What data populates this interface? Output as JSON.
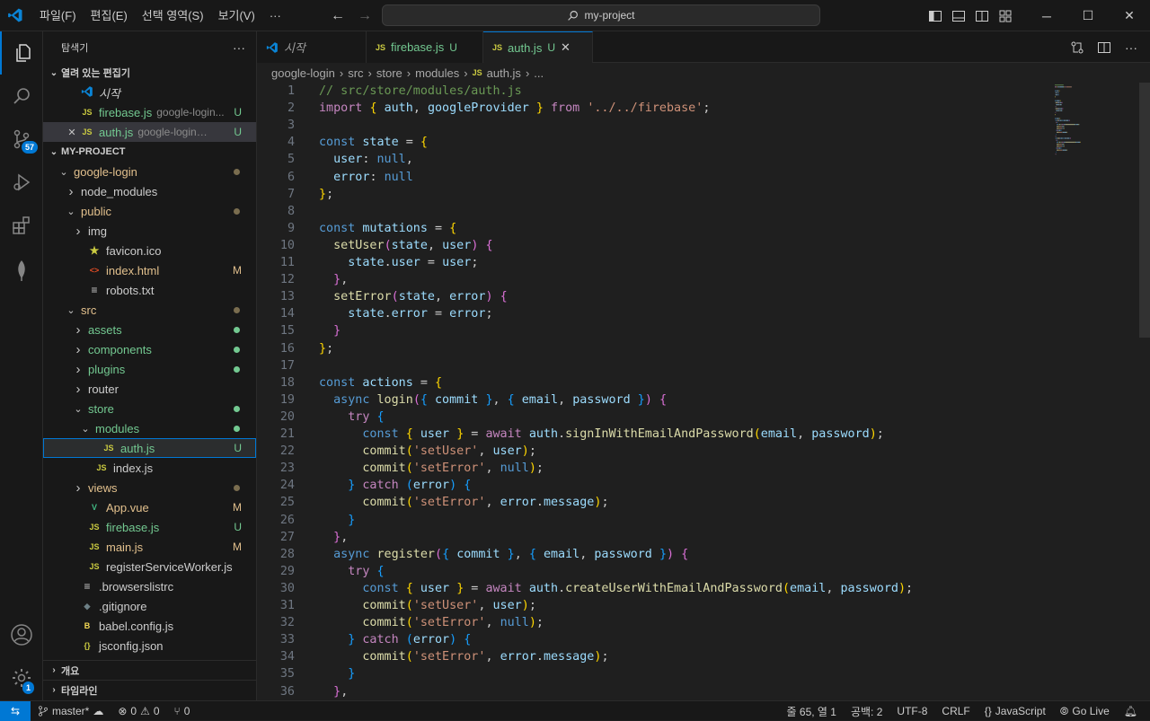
{
  "titlebar": {
    "menu": [
      "파일(F)",
      "편집(E)",
      "선택 영역(S)",
      "보기(V)",
      "···"
    ],
    "search_text": "my-project"
  },
  "activity_bar": {
    "items": [
      "explorer-icon",
      "search-icon",
      "source-control-icon",
      "run-debug-icon",
      "extensions-icon",
      "mongodb-icon"
    ],
    "source_control_badge": "57",
    "settings_badge": "1"
  },
  "sidebar": {
    "title": "탐색기",
    "more": "···",
    "open_editors_label": "열려 있는 편집기",
    "open_editors": [
      {
        "name": "시작",
        "desc": "",
        "status": "",
        "icon": "vscode-icon"
      },
      {
        "name": "firebase.js",
        "desc": "google-login...",
        "status": "U",
        "icon": "JS"
      },
      {
        "name": "auth.js",
        "desc": "google-login\\src...",
        "status": "U",
        "icon": "JS"
      }
    ],
    "project_label": "MY-PROJECT",
    "tree": [
      {
        "name": "google-login",
        "type": "folder-open",
        "depth": 0,
        "status": "dot"
      },
      {
        "name": "node_modules",
        "type": "folder",
        "depth": 1,
        "status": ""
      },
      {
        "name": "public",
        "type": "folder-open",
        "depth": 1,
        "status": "dot"
      },
      {
        "name": "img",
        "type": "folder",
        "depth": 2,
        "status": ""
      },
      {
        "name": "favicon.ico",
        "type": "star",
        "depth": 2,
        "status": ""
      },
      {
        "name": "index.html",
        "type": "html",
        "depth": 2,
        "status": "M"
      },
      {
        "name": "robots.txt",
        "type": "txt",
        "depth": 2,
        "status": ""
      },
      {
        "name": "src",
        "type": "folder-open",
        "depth": 1,
        "status": "dot"
      },
      {
        "name": "assets",
        "type": "folder",
        "depth": 2,
        "status": "dot-green"
      },
      {
        "name": "components",
        "type": "folder",
        "depth": 2,
        "status": "dot-green"
      },
      {
        "name": "plugins",
        "type": "folder",
        "depth": 2,
        "status": "dot-green"
      },
      {
        "name": "router",
        "type": "folder",
        "depth": 2,
        "status": ""
      },
      {
        "name": "store",
        "type": "folder-open",
        "depth": 2,
        "status": "dot-green"
      },
      {
        "name": "modules",
        "type": "folder-open",
        "depth": 3,
        "status": "dot-green"
      },
      {
        "name": "auth.js",
        "type": "js",
        "depth": 4,
        "status": "U"
      },
      {
        "name": "index.js",
        "type": "js",
        "depth": 3,
        "status": ""
      },
      {
        "name": "views",
        "type": "folder",
        "depth": 2,
        "status": "dot"
      },
      {
        "name": "App.vue",
        "type": "vue",
        "depth": 2,
        "status": "M"
      },
      {
        "name": "firebase.js",
        "type": "js",
        "depth": 2,
        "status": "U"
      },
      {
        "name": "main.js",
        "type": "js",
        "depth": 2,
        "status": "M"
      },
      {
        "name": "registerServiceWorker.js",
        "type": "js",
        "depth": 2,
        "status": ""
      },
      {
        "name": ".browserslistrc",
        "type": "txt",
        "depth": 1,
        "status": ""
      },
      {
        "name": ".gitignore",
        "type": "git",
        "depth": 1,
        "status": ""
      },
      {
        "name": "babel.config.js",
        "type": "babel",
        "depth": 1,
        "status": ""
      },
      {
        "name": "jsconfig.json",
        "type": "json",
        "depth": 1,
        "status": ""
      }
    ],
    "outline_label": "개요",
    "timeline_label": "타임라인"
  },
  "tabs": [
    {
      "label": "시작",
      "icon": "vscode-icon",
      "status": ""
    },
    {
      "label": "firebase.js",
      "icon": "JS",
      "status": "U"
    },
    {
      "label": "auth.js",
      "icon": "JS",
      "status": "U",
      "active": true
    }
  ],
  "breadcrumb": [
    "google-login",
    "src",
    "store",
    "modules",
    "auth.js",
    "..."
  ],
  "code_lines": [
    [
      [
        "c",
        "// src/store/modules/auth.js"
      ]
    ],
    [
      [
        "k",
        "import"
      ],
      [
        "p",
        " "
      ],
      [
        "b1",
        "{"
      ],
      [
        "p",
        " "
      ],
      [
        "v",
        "auth"
      ],
      [
        "p",
        ", "
      ],
      [
        "v",
        "googleProvider"
      ],
      [
        "p",
        " "
      ],
      [
        "b1",
        "}"
      ],
      [
        "p",
        " "
      ],
      [
        "k",
        "from"
      ],
      [
        "p",
        " "
      ],
      [
        "s",
        "'../../firebase'"
      ],
      [
        "p",
        ";"
      ]
    ],
    [],
    [
      [
        "kw",
        "const"
      ],
      [
        "p",
        " "
      ],
      [
        "v",
        "state"
      ],
      [
        "p",
        " = "
      ],
      [
        "b1",
        "{"
      ]
    ],
    [
      [
        "p",
        "  "
      ],
      [
        "v",
        "user"
      ],
      [
        "p",
        ": "
      ],
      [
        "kw",
        "null"
      ],
      [
        "p",
        ","
      ]
    ],
    [
      [
        "p",
        "  "
      ],
      [
        "v",
        "error"
      ],
      [
        "p",
        ": "
      ],
      [
        "kw",
        "null"
      ]
    ],
    [
      [
        "b1",
        "}"
      ],
      [
        "p",
        ";"
      ]
    ],
    [],
    [
      [
        "kw",
        "const"
      ],
      [
        "p",
        " "
      ],
      [
        "v",
        "mutations"
      ],
      [
        "p",
        " = "
      ],
      [
        "b1",
        "{"
      ]
    ],
    [
      [
        "p",
        "  "
      ],
      [
        "f",
        "setUser"
      ],
      [
        "b2",
        "("
      ],
      [
        "v",
        "state"
      ],
      [
        "p",
        ", "
      ],
      [
        "v",
        "user"
      ],
      [
        "b2",
        ")"
      ],
      [
        "p",
        " "
      ],
      [
        "b2",
        "{"
      ]
    ],
    [
      [
        "p",
        "    "
      ],
      [
        "v",
        "state"
      ],
      [
        "p",
        "."
      ],
      [
        "v",
        "user"
      ],
      [
        "p",
        " = "
      ],
      [
        "v",
        "user"
      ],
      [
        "p",
        ";"
      ]
    ],
    [
      [
        "p",
        "  "
      ],
      [
        "b2",
        "}"
      ],
      [
        "p",
        ","
      ]
    ],
    [
      [
        "p",
        "  "
      ],
      [
        "f",
        "setError"
      ],
      [
        "b2",
        "("
      ],
      [
        "v",
        "state"
      ],
      [
        "p",
        ", "
      ],
      [
        "v",
        "error"
      ],
      [
        "b2",
        ")"
      ],
      [
        "p",
        " "
      ],
      [
        "b2",
        "{"
      ]
    ],
    [
      [
        "p",
        "    "
      ],
      [
        "v",
        "state"
      ],
      [
        "p",
        "."
      ],
      [
        "v",
        "error"
      ],
      [
        "p",
        " = "
      ],
      [
        "v",
        "error"
      ],
      [
        "p",
        ";"
      ]
    ],
    [
      [
        "p",
        "  "
      ],
      [
        "b2",
        "}"
      ]
    ],
    [
      [
        "b1",
        "}"
      ],
      [
        "p",
        ";"
      ]
    ],
    [],
    [
      [
        "kw",
        "const"
      ],
      [
        "p",
        " "
      ],
      [
        "v",
        "actions"
      ],
      [
        "p",
        " = "
      ],
      [
        "b1",
        "{"
      ]
    ],
    [
      [
        "p",
        "  "
      ],
      [
        "kw",
        "async"
      ],
      [
        "p",
        " "
      ],
      [
        "f",
        "login"
      ],
      [
        "b2",
        "("
      ],
      [
        "b3",
        "{"
      ],
      [
        "p",
        " "
      ],
      [
        "v",
        "commit"
      ],
      [
        "p",
        " "
      ],
      [
        "b3",
        "}"
      ],
      [
        "p",
        ", "
      ],
      [
        "b3",
        "{"
      ],
      [
        "p",
        " "
      ],
      [
        "v",
        "email"
      ],
      [
        "p",
        ", "
      ],
      [
        "v",
        "password"
      ],
      [
        "p",
        " "
      ],
      [
        "b3",
        "}"
      ],
      [
        "b2",
        ")"
      ],
      [
        "p",
        " "
      ],
      [
        "b2",
        "{"
      ]
    ],
    [
      [
        "p",
        "    "
      ],
      [
        "k",
        "try"
      ],
      [
        "p",
        " "
      ],
      [
        "b3",
        "{"
      ]
    ],
    [
      [
        "p",
        "      "
      ],
      [
        "kw",
        "const"
      ],
      [
        "p",
        " "
      ],
      [
        "b1",
        "{"
      ],
      [
        "p",
        " "
      ],
      [
        "v",
        "user"
      ],
      [
        "p",
        " "
      ],
      [
        "b1",
        "}"
      ],
      [
        "p",
        " = "
      ],
      [
        "k",
        "await"
      ],
      [
        "p",
        " "
      ],
      [
        "v",
        "auth"
      ],
      [
        "p",
        "."
      ],
      [
        "f",
        "signInWithEmailAndPassword"
      ],
      [
        "b1",
        "("
      ],
      [
        "v",
        "email"
      ],
      [
        "p",
        ", "
      ],
      [
        "v",
        "password"
      ],
      [
        "b1",
        ")"
      ],
      [
        "p",
        ";"
      ]
    ],
    [
      [
        "p",
        "      "
      ],
      [
        "f",
        "commit"
      ],
      [
        "b1",
        "("
      ],
      [
        "s",
        "'setUser'"
      ],
      [
        "p",
        ", "
      ],
      [
        "v",
        "user"
      ],
      [
        "b1",
        ")"
      ],
      [
        "p",
        ";"
      ]
    ],
    [
      [
        "p",
        "      "
      ],
      [
        "f",
        "commit"
      ],
      [
        "b1",
        "("
      ],
      [
        "s",
        "'setError'"
      ],
      [
        "p",
        ", "
      ],
      [
        "kw",
        "null"
      ],
      [
        "b1",
        ")"
      ],
      [
        "p",
        ";"
      ]
    ],
    [
      [
        "p",
        "    "
      ],
      [
        "b3",
        "}"
      ],
      [
        "p",
        " "
      ],
      [
        "k",
        "catch"
      ],
      [
        "p",
        " "
      ],
      [
        "b3",
        "("
      ],
      [
        "v",
        "error"
      ],
      [
        "b3",
        ")"
      ],
      [
        "p",
        " "
      ],
      [
        "b3",
        "{"
      ]
    ],
    [
      [
        "p",
        "      "
      ],
      [
        "f",
        "commit"
      ],
      [
        "b1",
        "("
      ],
      [
        "s",
        "'setError'"
      ],
      [
        "p",
        ", "
      ],
      [
        "v",
        "error"
      ],
      [
        "p",
        "."
      ],
      [
        "v",
        "message"
      ],
      [
        "b1",
        ")"
      ],
      [
        "p",
        ";"
      ]
    ],
    [
      [
        "p",
        "    "
      ],
      [
        "b3",
        "}"
      ]
    ],
    [
      [
        "p",
        "  "
      ],
      [
        "b2",
        "}"
      ],
      [
        "p",
        ","
      ]
    ],
    [
      [
        "p",
        "  "
      ],
      [
        "kw",
        "async"
      ],
      [
        "p",
        " "
      ],
      [
        "f",
        "register"
      ],
      [
        "b2",
        "("
      ],
      [
        "b3",
        "{"
      ],
      [
        "p",
        " "
      ],
      [
        "v",
        "commit"
      ],
      [
        "p",
        " "
      ],
      [
        "b3",
        "}"
      ],
      [
        "p",
        ", "
      ],
      [
        "b3",
        "{"
      ],
      [
        "p",
        " "
      ],
      [
        "v",
        "email"
      ],
      [
        "p",
        ", "
      ],
      [
        "v",
        "password"
      ],
      [
        "p",
        " "
      ],
      [
        "b3",
        "}"
      ],
      [
        "b2",
        ")"
      ],
      [
        "p",
        " "
      ],
      [
        "b2",
        "{"
      ]
    ],
    [
      [
        "p",
        "    "
      ],
      [
        "k",
        "try"
      ],
      [
        "p",
        " "
      ],
      [
        "b3",
        "{"
      ]
    ],
    [
      [
        "p",
        "      "
      ],
      [
        "kw",
        "const"
      ],
      [
        "p",
        " "
      ],
      [
        "b1",
        "{"
      ],
      [
        "p",
        " "
      ],
      [
        "v",
        "user"
      ],
      [
        "p",
        " "
      ],
      [
        "b1",
        "}"
      ],
      [
        "p",
        " = "
      ],
      [
        "k",
        "await"
      ],
      [
        "p",
        " "
      ],
      [
        "v",
        "auth"
      ],
      [
        "p",
        "."
      ],
      [
        "f",
        "createUserWithEmailAndPassword"
      ],
      [
        "b1",
        "("
      ],
      [
        "v",
        "email"
      ],
      [
        "p",
        ", "
      ],
      [
        "v",
        "password"
      ],
      [
        "b1",
        ")"
      ],
      [
        "p",
        ";"
      ]
    ],
    [
      [
        "p",
        "      "
      ],
      [
        "f",
        "commit"
      ],
      [
        "b1",
        "("
      ],
      [
        "s",
        "'setUser'"
      ],
      [
        "p",
        ", "
      ],
      [
        "v",
        "user"
      ],
      [
        "b1",
        ")"
      ],
      [
        "p",
        ";"
      ]
    ],
    [
      [
        "p",
        "      "
      ],
      [
        "f",
        "commit"
      ],
      [
        "b1",
        "("
      ],
      [
        "s",
        "'setError'"
      ],
      [
        "p",
        ", "
      ],
      [
        "kw",
        "null"
      ],
      [
        "b1",
        ")"
      ],
      [
        "p",
        ";"
      ]
    ],
    [
      [
        "p",
        "    "
      ],
      [
        "b3",
        "}"
      ],
      [
        "p",
        " "
      ],
      [
        "k",
        "catch"
      ],
      [
        "p",
        " "
      ],
      [
        "b3",
        "("
      ],
      [
        "v",
        "error"
      ],
      [
        "b3",
        ")"
      ],
      [
        "p",
        " "
      ],
      [
        "b3",
        "{"
      ]
    ],
    [
      [
        "p",
        "      "
      ],
      [
        "f",
        "commit"
      ],
      [
        "b1",
        "("
      ],
      [
        "s",
        "'setError'"
      ],
      [
        "p",
        ", "
      ],
      [
        "v",
        "error"
      ],
      [
        "p",
        "."
      ],
      [
        "v",
        "message"
      ],
      [
        "b1",
        ")"
      ],
      [
        "p",
        ";"
      ]
    ],
    [
      [
        "p",
        "    "
      ],
      [
        "b3",
        "}"
      ]
    ],
    [
      [
        "p",
        "  "
      ],
      [
        "b2",
        "}"
      ],
      [
        "p",
        ","
      ]
    ]
  ],
  "statusbar": {
    "branch": "master*",
    "errors": "0",
    "warnings": "0",
    "ports": "0",
    "cursor": "줄 65, 열 1",
    "spaces": "공백: 2",
    "encoding": "UTF-8",
    "eol": "CRLF",
    "language": "JavaScript",
    "golive": "Go Live"
  },
  "colors": {
    "accent": "#0078d4",
    "untracked": "#73c991",
    "modified": "#e2c08d",
    "js_icon": "#cbcb41"
  }
}
